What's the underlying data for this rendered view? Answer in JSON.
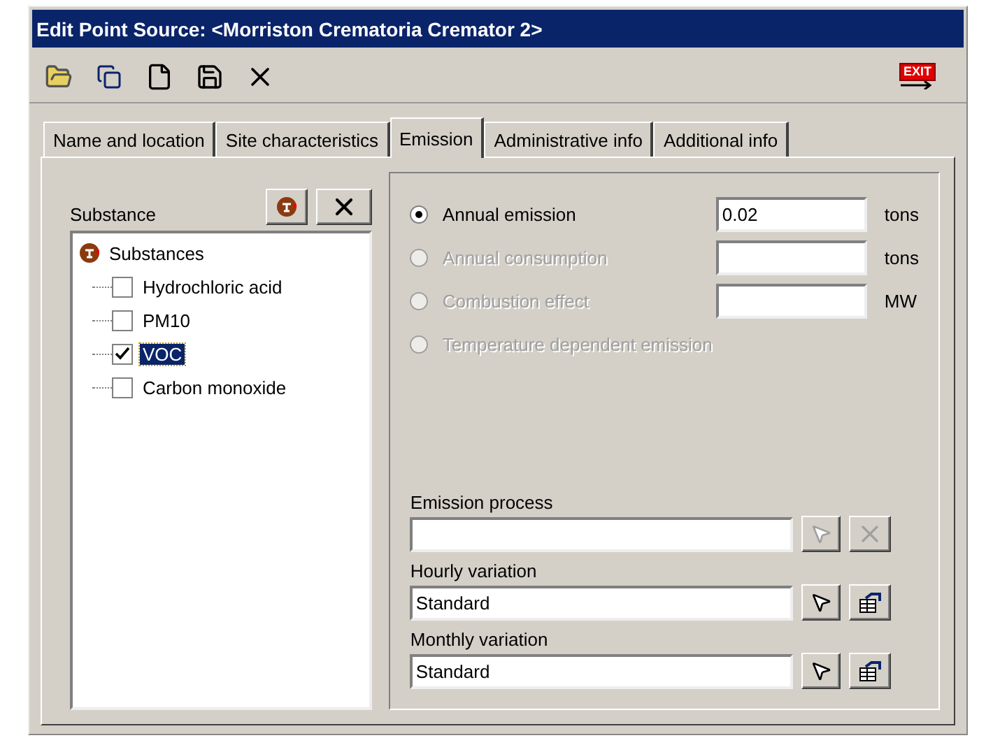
{
  "window": {
    "title": "Edit Point Source: <Morriston Crematoria Cremator 2>"
  },
  "toolbar": {
    "exit_label": "EXIT"
  },
  "tabs": [
    {
      "label": "Name and location",
      "selected": false
    },
    {
      "label": "Site characteristics",
      "selected": false
    },
    {
      "label": "Emission",
      "selected": true
    },
    {
      "label": "Administrative info",
      "selected": false
    },
    {
      "label": "Additional info",
      "selected": false
    }
  ],
  "substance": {
    "label": "Substance",
    "tree": {
      "label": "Substances",
      "children": [
        {
          "label": "Hydrochloric acid",
          "checked": false,
          "selected": false
        },
        {
          "label": "PM10",
          "checked": false,
          "selected": false
        },
        {
          "label": "VOC",
          "checked": true,
          "selected": true
        },
        {
          "label": "Carbon monoxide",
          "checked": false,
          "selected": false
        }
      ]
    }
  },
  "emission_options": [
    {
      "kind": "amount",
      "label": "Annual emission",
      "selected": true,
      "disabled": false,
      "value": "0.02",
      "unit": "tons"
    },
    {
      "kind": "amount",
      "label": "Annual consumption",
      "selected": false,
      "disabled": true,
      "unit": "tons"
    },
    {
      "kind": "amount",
      "label": "Combustion effect",
      "selected": false,
      "disabled": true,
      "unit": "MW"
    },
    {
      "kind": "plain",
      "label": "Temperature dependent emission",
      "selected": false,
      "disabled": true
    }
  ],
  "links": [
    {
      "kind": "removable",
      "label": "Emission process",
      "disabled": true
    },
    {
      "kind": "editable",
      "label": "Hourly variation",
      "value": "Standard",
      "disabled": false
    },
    {
      "kind": "editable",
      "label": "Monthly variation",
      "value": "Standard",
      "disabled": false
    }
  ]
}
